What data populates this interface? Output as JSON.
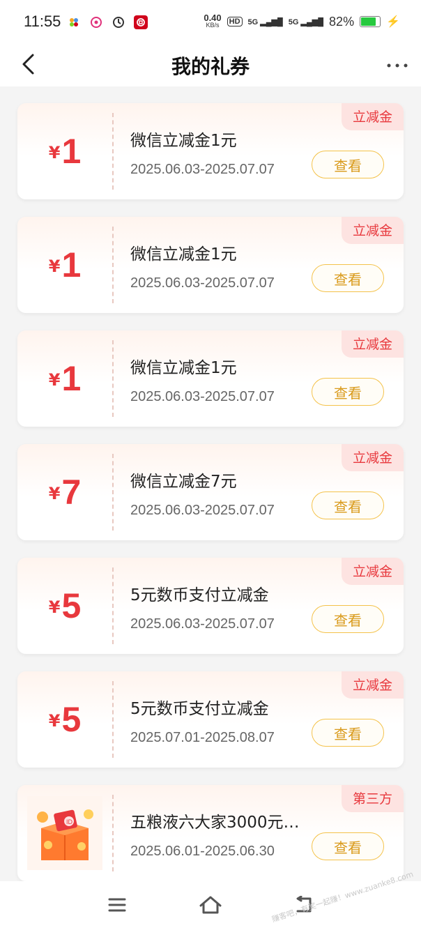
{
  "status": {
    "time": "11:55",
    "net_speed": "0.40",
    "net_unit": "KB/s",
    "hd": "HD",
    "signal1": "5G",
    "signal2": "5G",
    "battery": "82%",
    "battery_level": 0.82
  },
  "nav": {
    "title": "我的礼券"
  },
  "coupons": [
    {
      "currency": "¥",
      "amount": "1",
      "name": "微信立减金1元",
      "date": "2025.06.03-2025.07.07",
      "tag": "立减金",
      "button": "查看"
    },
    {
      "currency": "¥",
      "amount": "1",
      "name": "微信立减金1元",
      "date": "2025.06.03-2025.07.07",
      "tag": "立减金",
      "button": "查看"
    },
    {
      "currency": "¥",
      "amount": "1",
      "name": "微信立减金1元",
      "date": "2025.06.03-2025.07.07",
      "tag": "立减金",
      "button": "查看"
    },
    {
      "currency": "¥",
      "amount": "7",
      "name": "微信立减金7元",
      "date": "2025.06.03-2025.07.07",
      "tag": "立减金",
      "button": "查看"
    },
    {
      "currency": "¥",
      "amount": "5",
      "name": "5元数币支付立减金",
      "date": "2025.06.03-2025.07.07",
      "tag": "立减金",
      "button": "查看"
    },
    {
      "currency": "¥",
      "amount": "5",
      "name": "5元数币支付立减金",
      "date": "2025.07.01-2025.08.07",
      "tag": "立减金",
      "button": "查看"
    },
    {
      "image": "gift-box-icon",
      "name": "五粮液六大家3000元…",
      "date": "2025.06.01-2025.06.30",
      "tag": "第三方",
      "button": "查看"
    }
  ],
  "watermark": "赚客吧，有奖一起赚！www.zuanke8.com",
  "colors": {
    "accent_red": "#e8383d",
    "button_gold": "#f4c24a",
    "tag_bg": "#fde3e1"
  }
}
